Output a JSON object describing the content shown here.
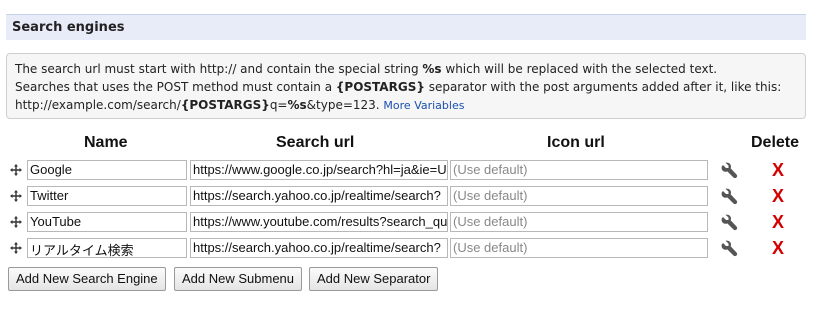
{
  "section": {
    "title": "Search engines"
  },
  "info": {
    "line1_pre": "The search url must start with http:// and contain the special string ",
    "line1_token": "%s",
    "line1_post": " which will be replaced with the selected text.",
    "line2_pre": "Searches that uses the POST method must contain a ",
    "line2_token": "{POSTARGS}",
    "line2_post": " separator with the post arguments added after it, like this:",
    "line3_a": "http://example.com/search/",
    "line3_token1": "{POSTARGS}",
    "line3_b": "q=",
    "line3_token2": "%s",
    "line3_c": "&type=123.",
    "more_link": "More Variables"
  },
  "columns": {
    "name": "Name",
    "url": "Search url",
    "icon": "Icon url",
    "delete": "Delete"
  },
  "rows": [
    {
      "name": "Google",
      "url": "https://www.google.co.jp/search?hl=ja&ie=U",
      "icon_placeholder": "(Use default)",
      "delete": "X"
    },
    {
      "name": "Twitter",
      "url": "https://search.yahoo.co.jp/realtime/search?",
      "icon_placeholder": "(Use default)",
      "delete": "X"
    },
    {
      "name": "YouTube",
      "url": "https://www.youtube.com/results?search_qu",
      "icon_placeholder": "(Use default)",
      "delete": "X"
    },
    {
      "name": "リアルタイム検索",
      "url": "https://search.yahoo.co.jp/realtime/search?",
      "icon_placeholder": "(Use default)",
      "delete": "X"
    }
  ],
  "buttons": {
    "add_engine": "Add New Search Engine",
    "add_submenu": "Add New Submenu",
    "add_separator": "Add New Separator"
  },
  "icons": {
    "drag": "move-handle-icon",
    "edit": "wrench-icon",
    "delete": "close-x-icon"
  },
  "colors": {
    "header_bg": "#e8ecf9",
    "delete": "#d40000",
    "link": "#1a4fb0"
  }
}
